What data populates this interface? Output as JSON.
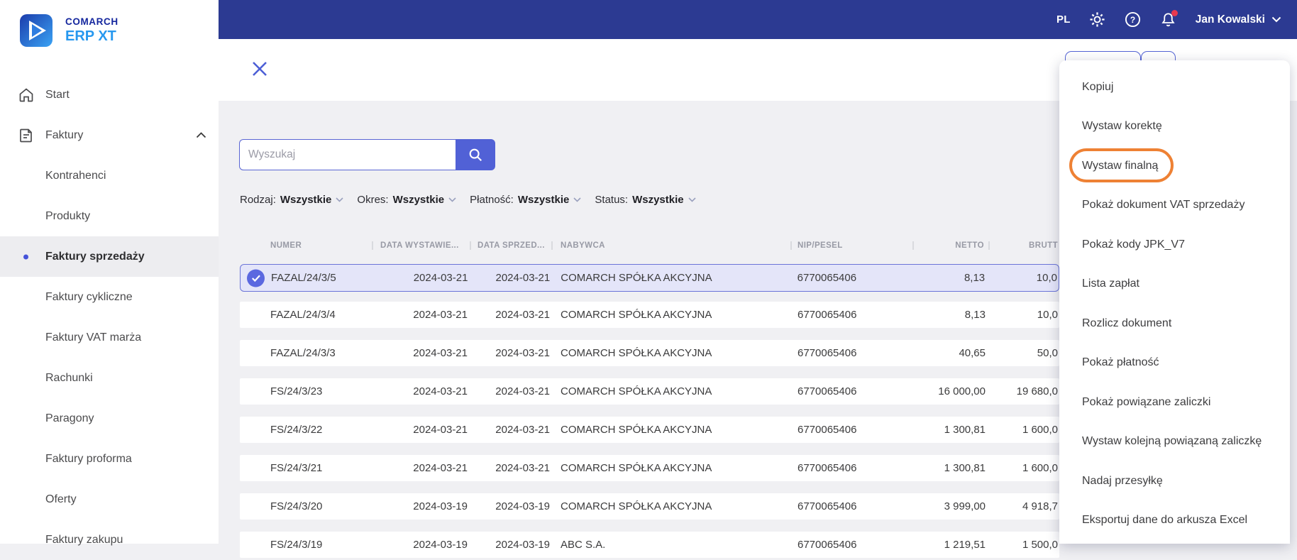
{
  "brand": {
    "line1": "COMARCH",
    "line2": "ERP XT"
  },
  "topbar": {
    "language": "PL",
    "user": "Jan Kowalski",
    "icons": [
      "gear-icon",
      "help-icon",
      "bell-icon",
      "chevron-down-icon"
    ],
    "bar_color": "#2c3a92",
    "notification_dot_color": "#e8384f"
  },
  "sidebar": {
    "items": [
      {
        "label": "Start",
        "icon": "home",
        "child": false,
        "selected": false
      },
      {
        "label": "Faktury",
        "icon": "document",
        "child": false,
        "selected": false,
        "expanded": true
      },
      {
        "label": "Kontrahenci",
        "child": true,
        "selected": false
      },
      {
        "label": "Produkty",
        "child": true,
        "selected": false
      },
      {
        "label": "Faktury sprzedaży",
        "child": true,
        "selected": true
      },
      {
        "label": "Faktury cykliczne",
        "child": true,
        "selected": false
      },
      {
        "label": "Faktury VAT marża",
        "child": true,
        "selected": false
      },
      {
        "label": "Rachunki",
        "child": true,
        "selected": false
      },
      {
        "label": "Paragony",
        "child": true,
        "selected": false
      },
      {
        "label": "Faktury proforma",
        "child": true,
        "selected": false
      },
      {
        "label": "Oferty",
        "child": true,
        "selected": false
      },
      {
        "label": "Faktury zakupu",
        "child": true,
        "selected": false
      }
    ]
  },
  "search": {
    "placeholder": "Wyszukaj"
  },
  "filters": [
    {
      "label": "Rodzaj:",
      "value": "Wszystkie"
    },
    {
      "label": "Okres:",
      "value": "Wszystkie"
    },
    {
      "label": "Płatność:",
      "value": "Wszystkie"
    },
    {
      "label": "Status:",
      "value": "Wszystkie"
    }
  ],
  "table": {
    "columns": [
      "NUMER",
      "DATA WYSTAWIE...",
      "DATA SPRZED...",
      "NABYWCA",
      "NIP/PESEL",
      "NETTO",
      "BRUTT"
    ],
    "rows": [
      {
        "numer": "FAZAL/24/3/5",
        "data_wystawienia": "2024-03-21",
        "data_sprzedazy": "2024-03-21",
        "nabywca": "COMARCH SPÓŁKA AKCYJNA",
        "nip_pesel": "6770065406",
        "netto": "8,13",
        "brutto": "10,0",
        "selected": true,
        "partial": false
      },
      {
        "numer": "FAZAL/24/3/4",
        "data_wystawienia": "2024-03-21",
        "data_sprzedazy": "2024-03-21",
        "nabywca": "COMARCH SPÓŁKA AKCYJNA",
        "nip_pesel": "6770065406",
        "netto": "8,13",
        "brutto": "10,0",
        "selected": false,
        "partial": false
      },
      {
        "numer": "FAZAL/24/3/3",
        "data_wystawienia": "2024-03-21",
        "data_sprzedazy": "2024-03-21",
        "nabywca": "COMARCH SPÓŁKA AKCYJNA",
        "nip_pesel": "6770065406",
        "netto": "40,65",
        "brutto": "50,0",
        "selected": false,
        "partial": false
      },
      {
        "numer": "FS/24/3/23",
        "data_wystawienia": "2024-03-21",
        "data_sprzedazy": "2024-03-21",
        "nabywca": "COMARCH SPÓŁKA AKCYJNA",
        "nip_pesel": "6770065406",
        "netto": "16 000,00",
        "brutto": "19 680,0",
        "selected": false,
        "partial": false
      },
      {
        "numer": "FS/24/3/22",
        "data_wystawienia": "2024-03-21",
        "data_sprzedazy": "2024-03-21",
        "nabywca": "COMARCH SPÓŁKA AKCYJNA",
        "nip_pesel": "6770065406",
        "netto": "1 300,81",
        "brutto": "1 600,0",
        "selected": false,
        "partial": false
      },
      {
        "numer": "FS/24/3/21",
        "data_wystawienia": "2024-03-21",
        "data_sprzedazy": "2024-03-21",
        "nabywca": "COMARCH SPÓŁKA AKCYJNA",
        "nip_pesel": "6770065406",
        "netto": "1 300,81",
        "brutto": "1 600,0",
        "selected": false,
        "partial": false
      },
      {
        "numer": "FS/24/3/20",
        "data_wystawienia": "2024-03-19",
        "data_sprzedazy": "2024-03-19",
        "nabywca": "COMARCH SPÓŁKA AKCYJNA",
        "nip_pesel": "6770065406",
        "netto": "3 999,00",
        "brutto": "4 918,7",
        "selected": false,
        "partial": false
      },
      {
        "numer": "FS/24/3/19",
        "data_wystawienia": "2024-03-19",
        "data_sprzedazy": "2024-03-19",
        "nabywca": "ABC S.A.",
        "nip_pesel": "6770065406",
        "netto": "1 219,51",
        "brutto": "1 500,0",
        "selected": false,
        "partial": true
      }
    ]
  },
  "context_menu": {
    "items": [
      "Kopiuj",
      "Wystaw korektę",
      "Wystaw finalną",
      "Pokaż dokument VAT sprzedaży",
      "Pokaż kody JPK_V7",
      "Lista zapłat",
      "Rozlicz dokument",
      "Pokaż płatność",
      "Pokaż powiązane zaliczki",
      "Wystaw kolejną powiązaną zaliczkę",
      "Nadaj przesyłkę",
      "Eksportuj dane do arkusza Excel"
    ],
    "highlighted_item": "Wystaw finalną",
    "highlight_color": "#ee8134"
  }
}
